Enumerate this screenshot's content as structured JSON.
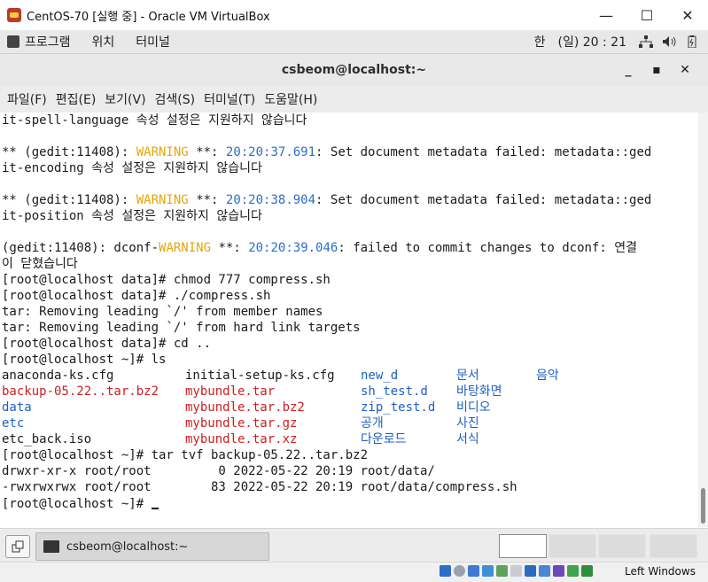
{
  "vbox": {
    "title": "CentOS-70 [실행 중] - Oracle VM VirtualBox",
    "minimize": "—",
    "maximize": "☐",
    "close": "✕"
  },
  "gnome": {
    "menu": [
      "프로그램",
      "위치",
      "터미널"
    ],
    "lang": "한",
    "clock": "(일) 20 : 21"
  },
  "terminal_window": {
    "title": "csbeom@localhost:~",
    "minimize": "_",
    "maximize": "▪",
    "close": "✕"
  },
  "menubar": [
    "파일(F)",
    "편집(E)",
    "보기(V)",
    "검색(S)",
    "터미널(T)",
    "도움말(H)"
  ],
  "terminal": {
    "l1": "it-spell-language 속성 설정은 지원하지 않습니다",
    "l3_pre": "** (gedit:11408): ",
    "l3_warn": "WARNING",
    "l3_mid": " **: ",
    "l3_ts": "20:20:37.691",
    "l3_post": ": Set document metadata failed: metadata::ged",
    "l4": "it-encoding 속성 설정은 지원하지 않습니다",
    "l6_pre": "** (gedit:11408): ",
    "l6_warn": "WARNING",
    "l6_mid": " **: ",
    "l6_ts": "20:20:38.904",
    "l6_post": ": Set document metadata failed: metadata::ged",
    "l7": "it-position 속성 설정은 지원하지 않습니다",
    "l9_pre": "(gedit:11408): dconf-",
    "l9_warn": "WARNING",
    "l9_mid": " **: ",
    "l9_ts": "20:20:39.046",
    "l9_post": ": failed to commit changes to dconf: 연결",
    "l10": "이 닫혔습니다",
    "l11": "[root@localhost data]# chmod 777 compress.sh",
    "l12": "[root@localhost data]# ./compress.sh",
    "l13": "tar: Removing leading `/' from member names",
    "l14": "tar: Removing leading `/' from hard link targets",
    "l15": "[root@localhost data]# cd ..",
    "l16": "[root@localhost ~]# ls",
    "ls": [
      [
        "anaconda-ks.cfg",
        "initial-setup-ks.cfg",
        "new_d",
        "문서",
        "음악"
      ],
      [
        "backup-05.22..tar.bz2",
        "mybundle.tar",
        "sh_test.d",
        "바탕화면",
        ""
      ],
      [
        "data",
        "mybundle.tar.bz2",
        "zip_test.d",
        "비디오",
        ""
      ],
      [
        "etc",
        "mybundle.tar.gz",
        "공개",
        "사진",
        ""
      ],
      [
        "etc_back.iso",
        "mybundle.tar.xz",
        "다운로드",
        "서식",
        ""
      ]
    ],
    "l22": "[root@localhost ~]# tar tvf backup-05.22..tar.bz2",
    "l23": "drwxr-xr-x root/root         0 2022-05-22 20:19 root/data/",
    "l24": "-rwxrwxrwx root/root        83 2022-05-22 20:19 root/data/compress.sh",
    "l25": "[root@localhost ~]# "
  },
  "taskbar": {
    "task_label": "csbeom@localhost:~"
  },
  "statusbar": {
    "host_key": "Left Windows"
  },
  "colors": {
    "warning": "#e5a50a",
    "timestamp": "#2a70c8",
    "archive": "#cc1f1f",
    "directory": "#1e5fc4"
  }
}
